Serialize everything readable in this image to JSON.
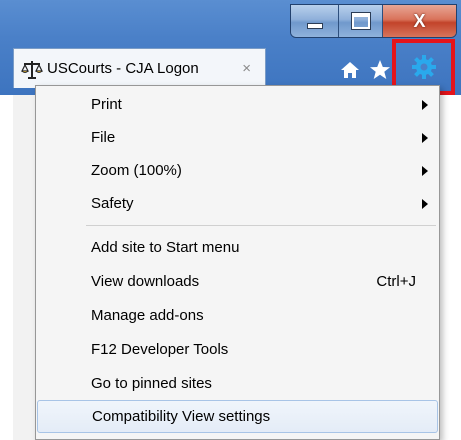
{
  "window": {
    "caption_close_glyph": "X"
  },
  "tab": {
    "title": "USCourts - CJA Logon",
    "close_glyph": "×"
  },
  "toolbar": {
    "home_icon": "home-icon",
    "favorites_icon": "star-icon",
    "tools_icon": "gear-icon",
    "highlight_color": "#e4141b"
  },
  "menu": {
    "items": [
      {
        "label": "Print",
        "submenu": true
      },
      {
        "label": "File",
        "submenu": true
      },
      {
        "label": "Zoom (100%)",
        "submenu": true
      },
      {
        "label": "Safety",
        "submenu": true
      },
      {
        "label": "Add site to Start menu"
      },
      {
        "label": "View downloads",
        "shortcut": "Ctrl+J"
      },
      {
        "label": "Manage add-ons"
      },
      {
        "label": "F12 Developer Tools"
      },
      {
        "label": "Go to pinned sites"
      },
      {
        "label": "Compatibility View settings",
        "highlighted": true
      }
    ]
  }
}
